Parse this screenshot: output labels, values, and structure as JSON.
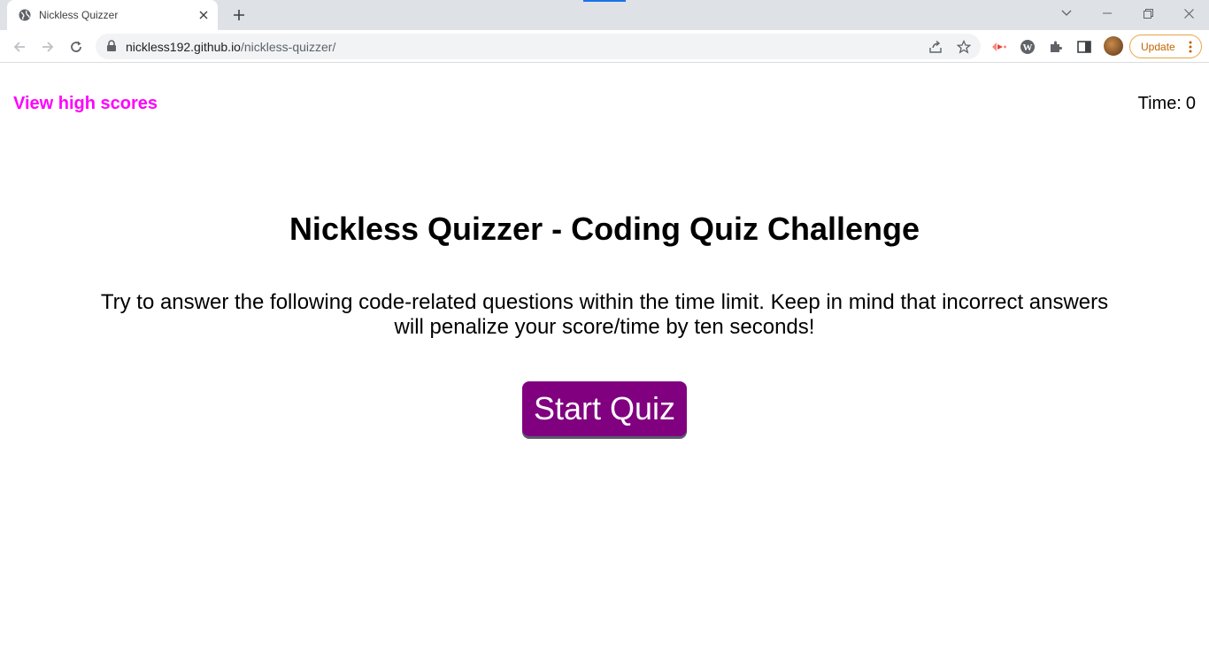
{
  "browser": {
    "tab_title": "Nickless Quizzer",
    "url_host": "nickless192.github.io",
    "url_path": "/nickless-quizzer/",
    "update_label": "Update"
  },
  "header": {
    "high_scores_label": "View high scores",
    "timer_label": "Time:",
    "timer_value": "0"
  },
  "main": {
    "title": "Nickless Quizzer - Coding Quiz Challenge",
    "description_line1": "Try to answer the following code-related questions within the time limit. Keep in mind that incorrect answers",
    "description_line2": "will penalize your score/time by ten seconds!",
    "start_button_label": "Start Quiz"
  },
  "colors": {
    "accent": "#ff00ff",
    "button_bg": "#800080",
    "button_text": "#ffffff"
  }
}
